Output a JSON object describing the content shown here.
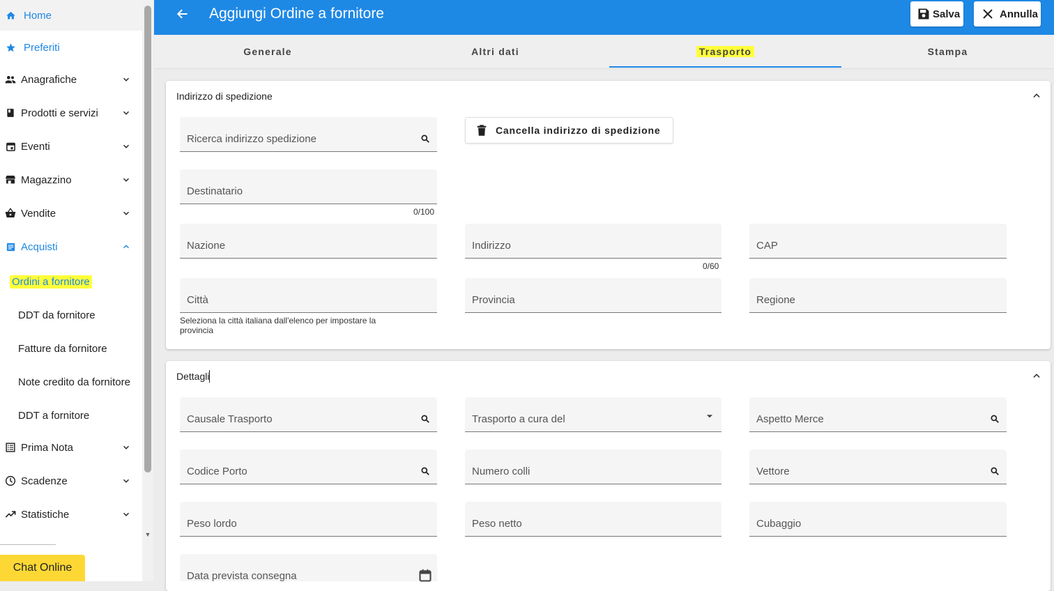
{
  "sidebar": {
    "home": "Home",
    "favorites": "Preferiti",
    "items": [
      {
        "label": "Anagrafiche"
      },
      {
        "label": "Prodotti e servizi"
      },
      {
        "label": "Eventi"
      },
      {
        "label": "Magazzino"
      },
      {
        "label": "Vendite"
      },
      {
        "label": "Acquisti"
      }
    ],
    "acquisti_sub": [
      {
        "label": "Ordini a fornitore"
      },
      {
        "label": "DDT da fornitore"
      },
      {
        "label": "Fatture da fornitore"
      },
      {
        "label": "Note credito da fornitore"
      },
      {
        "label": "DDT a fornitore"
      }
    ],
    "items_after": [
      {
        "label": "Prima Nota"
      },
      {
        "label": "Scadenze"
      },
      {
        "label": "Statistiche"
      }
    ],
    "chat": "Chat Online"
  },
  "header": {
    "title": "Aggiungi Ordine a fornitore",
    "save": "Salva",
    "cancel": "Annulla",
    "accent": "#1e88e5",
    "highlight": "#ffff3a"
  },
  "tabs": [
    "Generale",
    "Altri dati",
    "Trasporto",
    "Stampa"
  ],
  "shipping": {
    "title": "Indirizzo di spedizione",
    "search": "Ricerca indirizzo spedizione",
    "delete_button": "Cancella indirizzo di spedizione",
    "recipient": "Destinatario",
    "recipient_counter": "0/100",
    "nation": "Nazione",
    "address": "Indirizzo",
    "address_counter": "0/60",
    "cap": "CAP",
    "city": "Città",
    "city_hint": "Seleziona la città italiana dall'elenco per impostare la provincia",
    "province": "Provincia",
    "region": "Regione"
  },
  "details": {
    "title": "Dettagli",
    "transport_reason": "Causale Trasporto",
    "transport_by": "Trasporto a cura del",
    "goods_appearance": "Aspetto Merce",
    "port_code": "Codice Porto",
    "packages": "Numero colli",
    "carrier": "Vettore",
    "gross_weight": "Peso lordo",
    "net_weight": "Peso netto",
    "volume": "Cubaggio",
    "delivery_date": "Data prevista consegna"
  }
}
